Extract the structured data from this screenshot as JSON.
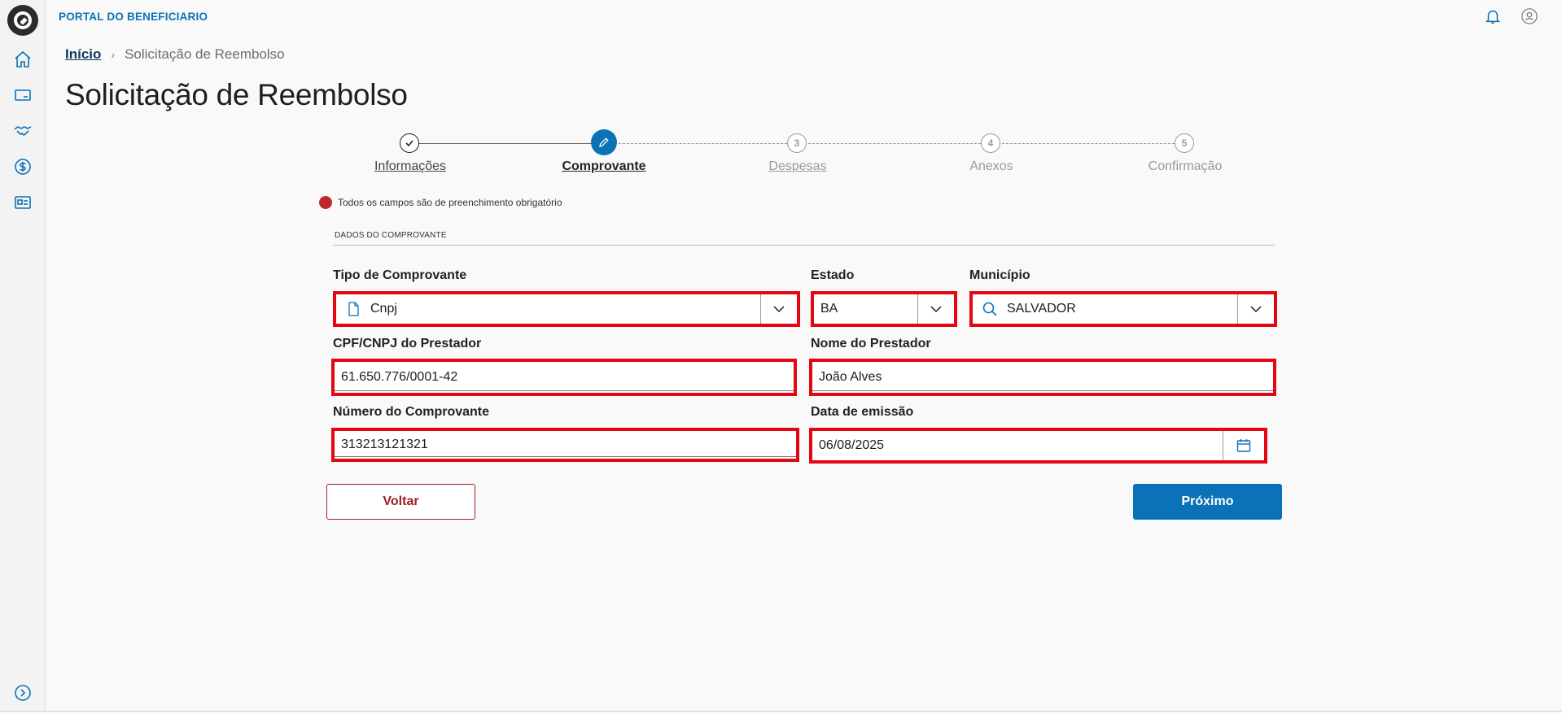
{
  "header": {
    "app_title": "PORTAL DO BENEFICIARIO"
  },
  "breadcrumb": {
    "home": "Início",
    "current": "Solicitação de Reembolso"
  },
  "page_title": "Solicitação de Reembolso",
  "stepper": {
    "steps": [
      {
        "label": "Informações",
        "number": "",
        "state": "done"
      },
      {
        "label": "Comprovante",
        "number": "",
        "state": "active"
      },
      {
        "label": "Despesas",
        "number": "3",
        "state": "pending"
      },
      {
        "label": "Anexos",
        "number": "4",
        "state": "pending"
      },
      {
        "label": "Confirmação",
        "number": "5",
        "state": "pending"
      }
    ]
  },
  "required_note": "Todos os campos são de preenchimento obrigatório",
  "section_title": "DADOS DO COMPROVANTE",
  "form": {
    "tipo": {
      "label": "Tipo de Comprovante",
      "value": "Cnpj"
    },
    "estado": {
      "label": "Estado",
      "value": "BA"
    },
    "municipio": {
      "label": "Município",
      "value": "SALVADOR"
    },
    "cpf_cnpj": {
      "label": "CPF/CNPJ do Prestador",
      "value": "61.650.776/0001-42"
    },
    "nome": {
      "label": "Nome do Prestador",
      "value": "João Alves"
    },
    "numero": {
      "label": "Número do Comprovante",
      "value": "313213121321"
    },
    "data": {
      "label": "Data de emissão",
      "value": "06/08/2025"
    }
  },
  "buttons": {
    "back": "Voltar",
    "next": "Próximo"
  },
  "colors": {
    "accent": "#0c72b7",
    "highlight": "#e30613",
    "required": "#c0272d",
    "back": "#a01e26"
  }
}
